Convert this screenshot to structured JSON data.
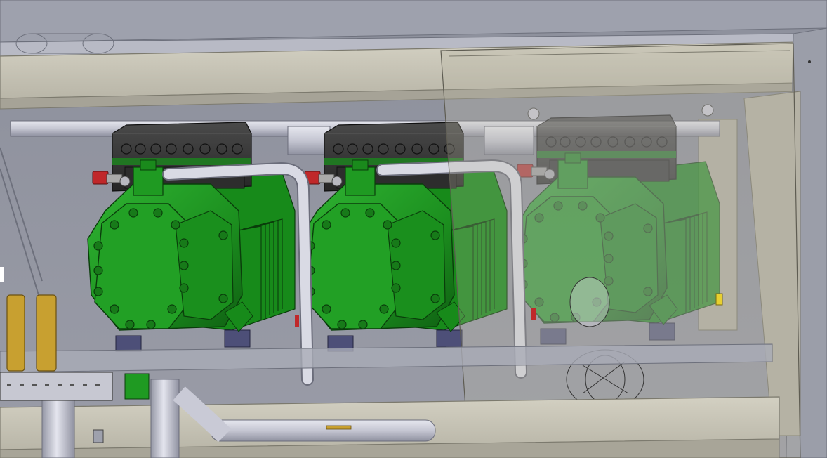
{
  "scene": {
    "kind": "cad-3d-viewport",
    "colors": {
      "background": "#8a8d99",
      "frame_beige": "#c7c4b6",
      "frame_shadow": "#9f9c8f",
      "pipe": "#c9cad6",
      "pipe_dark": "#8e909e",
      "compressor_green": "#1f9a22",
      "compressor_dark": "#0f5f12",
      "terminal_box": "#3b3b3b",
      "valve_red": "#c0282a",
      "brass": "#c8a030",
      "mount_blue": "#4d4f78"
    },
    "compressors": [
      {
        "id": "compressor-1",
        "transparent": false
      },
      {
        "id": "compressor-2",
        "transparent": false
      },
      {
        "id": "compressor-3",
        "transparent": true
      }
    ]
  }
}
